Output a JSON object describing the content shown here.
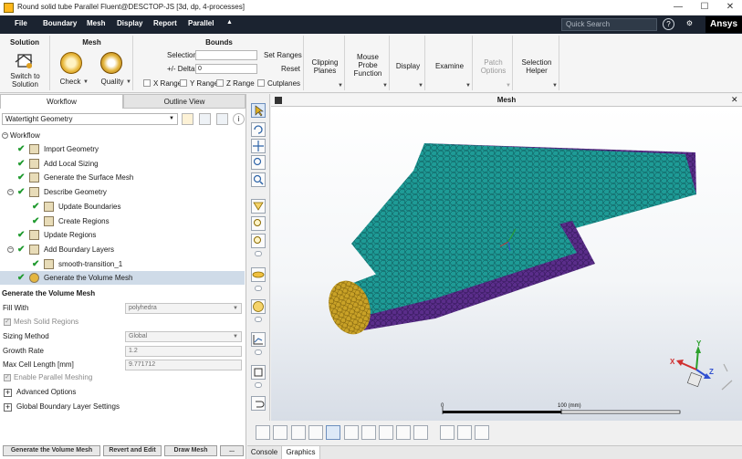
{
  "window": {
    "title": "Round solid tube Parallel Fluent@DESCTOP-JS [3d, dp, 4-processes]",
    "minimize": "—",
    "maximize": "☐",
    "close": "✕"
  },
  "menu": {
    "file": "File",
    "items": [
      "Boundary",
      "Mesh",
      "Display",
      "Report",
      "Parallel"
    ],
    "collapse_arrow": "▲",
    "search_placeholder": "Quick Search",
    "brand": "Ansys"
  },
  "ribbon": {
    "solution": {
      "title": "Solution",
      "switch_label_1": "Switch to",
      "switch_label_2": "Solution"
    },
    "mesh": {
      "title": "Mesh",
      "check": "Check",
      "quality": "Quality"
    },
    "bounds": {
      "title": "Bounds",
      "selection_label": "Selection",
      "selection_value": "",
      "delta_label": "+/- Delta",
      "delta_value": "0",
      "set_ranges": "Set Ranges",
      "reset": "Reset",
      "x_range": "X Range",
      "y_range": "Y Range",
      "z_range": "Z Range",
      "cutplanes": "Cutplanes"
    },
    "clipping_1": "Clipping",
    "clipping_2": "Planes",
    "probe_1": "Mouse",
    "probe_2": "Probe",
    "probe_3": "Function",
    "display": "Display",
    "examine": "Examine",
    "patch_1": "Patch",
    "patch_2": "Options",
    "sel_helper_1": "Selection",
    "sel_helper_2": "Helper"
  },
  "panel": {
    "tab_workflow": "Workflow",
    "tab_outline": "Outline View",
    "workflow_type": "Watertight Geometry",
    "root": "Workflow",
    "tree": [
      {
        "label": "Import Geometry",
        "indent": 1
      },
      {
        "label": "Add Local Sizing",
        "indent": 1
      },
      {
        "label": "Generate the Surface Mesh",
        "indent": 1
      },
      {
        "label": "Describe Geometry",
        "indent": 1,
        "expand": true
      },
      {
        "label": "Update Boundaries",
        "indent": 2
      },
      {
        "label": "Create Regions",
        "indent": 2
      },
      {
        "label": "Update Regions",
        "indent": 1
      },
      {
        "label": "Add Boundary Layers",
        "indent": 1,
        "expand": true
      },
      {
        "label": "smooth-transition_1",
        "indent": 2
      },
      {
        "label": "Generate the Volume Mesh",
        "indent": 1,
        "selected": true
      }
    ],
    "task_title": "Generate the Volume Mesh",
    "fill_with_label": "Fill With",
    "fill_with_value": "polyhedra",
    "mesh_solid_regions": "Mesh Solid Regions",
    "sizing_method_label": "Sizing Method",
    "sizing_method_value": "Global",
    "growth_rate_label": "Growth Rate",
    "growth_rate_value": "1.2",
    "max_cell_label": "Max Cell Length [mm]",
    "max_cell_value": "9.771712",
    "parallel_meshing": "Enable Parallel Meshing",
    "advanced_options": "Advanced Options",
    "global_bl": "Global Boundary Layer Settings",
    "btn_generate": "Generate the Volume Mesh",
    "btn_revert": "Revert and Edit",
    "btn_draw": "Draw Mesh",
    "btn_more": "..."
  },
  "graphics": {
    "title": "Mesh",
    "scale_start": "0",
    "scale_end": "100 (mm)",
    "close": "✕"
  },
  "bottom_tabs": [
    "Console",
    "Graphics"
  ],
  "colors": {
    "menu_bg": "#1b2330",
    "mesh_surface": "#1e9b96",
    "mesh_side": "#5a2d8a",
    "inlet_face": "#c9a227",
    "check": "#1f9a2e"
  }
}
